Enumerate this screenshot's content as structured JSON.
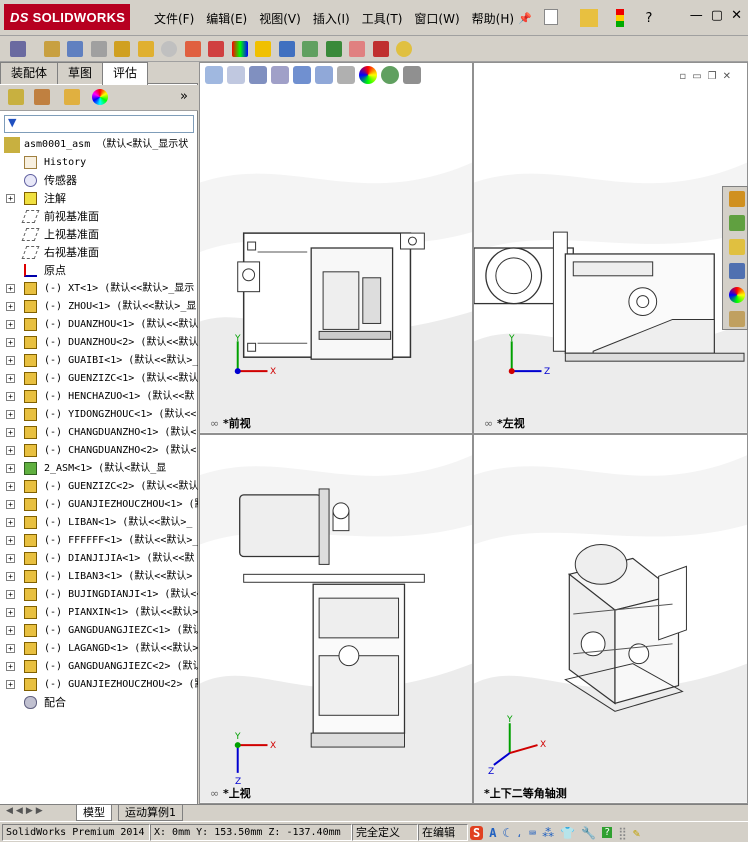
{
  "app": {
    "logo_text": "SOLIDWORKS"
  },
  "menu": [
    "文件(F)",
    "编辑(E)",
    "视图(V)",
    "插入(I)",
    "工具(T)",
    "窗口(W)",
    "帮助(H)"
  ],
  "panel_tabs": [
    "装配体",
    "草图",
    "评估"
  ],
  "tree": {
    "root": "asm0001_asm （默认<默认_显示状",
    "items": [
      {
        "label": "History",
        "type": "history"
      },
      {
        "label": "传感器",
        "type": "sensor"
      },
      {
        "label": "注解",
        "type": "annotation"
      },
      {
        "label": "前视基准面",
        "type": "plane"
      },
      {
        "label": "上视基准面",
        "type": "plane"
      },
      {
        "label": "右视基准面",
        "type": "plane"
      },
      {
        "label": "原点",
        "type": "origin"
      },
      {
        "label": "(-) XT<1> (默认<<默认>_显示",
        "type": "part"
      },
      {
        "label": "(-) ZHOU<1> (默认<<默认>_显",
        "type": "part"
      },
      {
        "label": "(-) DUANZHOU<1> (默认<<默认",
        "type": "part"
      },
      {
        "label": "(-) DUANZHOU<2> (默认<<默认",
        "type": "part"
      },
      {
        "label": "(-) GUAIBI<1> (默认<<默认>_",
        "type": "part"
      },
      {
        "label": "(-) GUENZIZC<1> (默认<<默认",
        "type": "part"
      },
      {
        "label": "(-) HENCHAZUO<1> (默认<<默",
        "type": "part"
      },
      {
        "label": "(-) YIDONGZHOUC<1> (默认<<",
        "type": "part"
      },
      {
        "label": "(-) CHANGDUANZHO<1> (默认<",
        "type": "part"
      },
      {
        "label": "(-) CHANGDUANZHO<2> (默认<",
        "type": "part"
      },
      {
        "label": "2_ASM<1> (默认<默认_显",
        "type": "subasm"
      },
      {
        "label": "(-) GUENZIZC<2> (默认<<默认",
        "type": "part"
      },
      {
        "label": "(-) GUANJIEZHOUCZHOU<1> (默",
        "type": "part"
      },
      {
        "label": "(-) LIBAN<1> (默认<<默认>_",
        "type": "part"
      },
      {
        "label": "(-) FFFFFF<1> (默认<<默认>_",
        "type": "part"
      },
      {
        "label": "(-) DIANJIJIA<1> (默认<<默",
        "type": "part"
      },
      {
        "label": "(-) LIBAN3<1> (默认<<默认>",
        "type": "part"
      },
      {
        "label": "(-) BUJINGDIANJI<1> (默认<<",
        "type": "part"
      },
      {
        "label": "(-) PIANXIN<1> (默认<<默认>",
        "type": "part"
      },
      {
        "label": "(-) GANGDUANGJIEZC<1> (默认",
        "type": "part"
      },
      {
        "label": "(-) LAGANGD<1> (默认<<默认>",
        "type": "part"
      },
      {
        "label": "(-) GANGDUANGJIEZC<2> (默认",
        "type": "part"
      },
      {
        "label": "(-) GUANJIEZHOUCZHOU<2> (默",
        "type": "part"
      },
      {
        "label": "配合",
        "type": "mates"
      }
    ]
  },
  "views": [
    {
      "label": "*前视",
      "id": "front"
    },
    {
      "label": "*左视",
      "id": "left"
    },
    {
      "label": "*上视",
      "id": "top"
    },
    {
      "label": "*上下二等角轴测",
      "id": "iso"
    }
  ],
  "axis": {
    "x": "X",
    "y": "Y",
    "z": "Z"
  },
  "bottom_tabs": [
    "模型",
    "运动算例1"
  ],
  "status": {
    "product": "SolidWorks Premium 2014",
    "coords": "X: 0mm Y: 153.50mm Z: -137.40mm",
    "state": "完全定义",
    "mode": "在编辑"
  },
  "colors": {
    "accent": "#b70020",
    "selection": "#316ac5",
    "axis_x": "#d00000",
    "axis_y": "#00a000",
    "axis_z": "#0000d0"
  }
}
